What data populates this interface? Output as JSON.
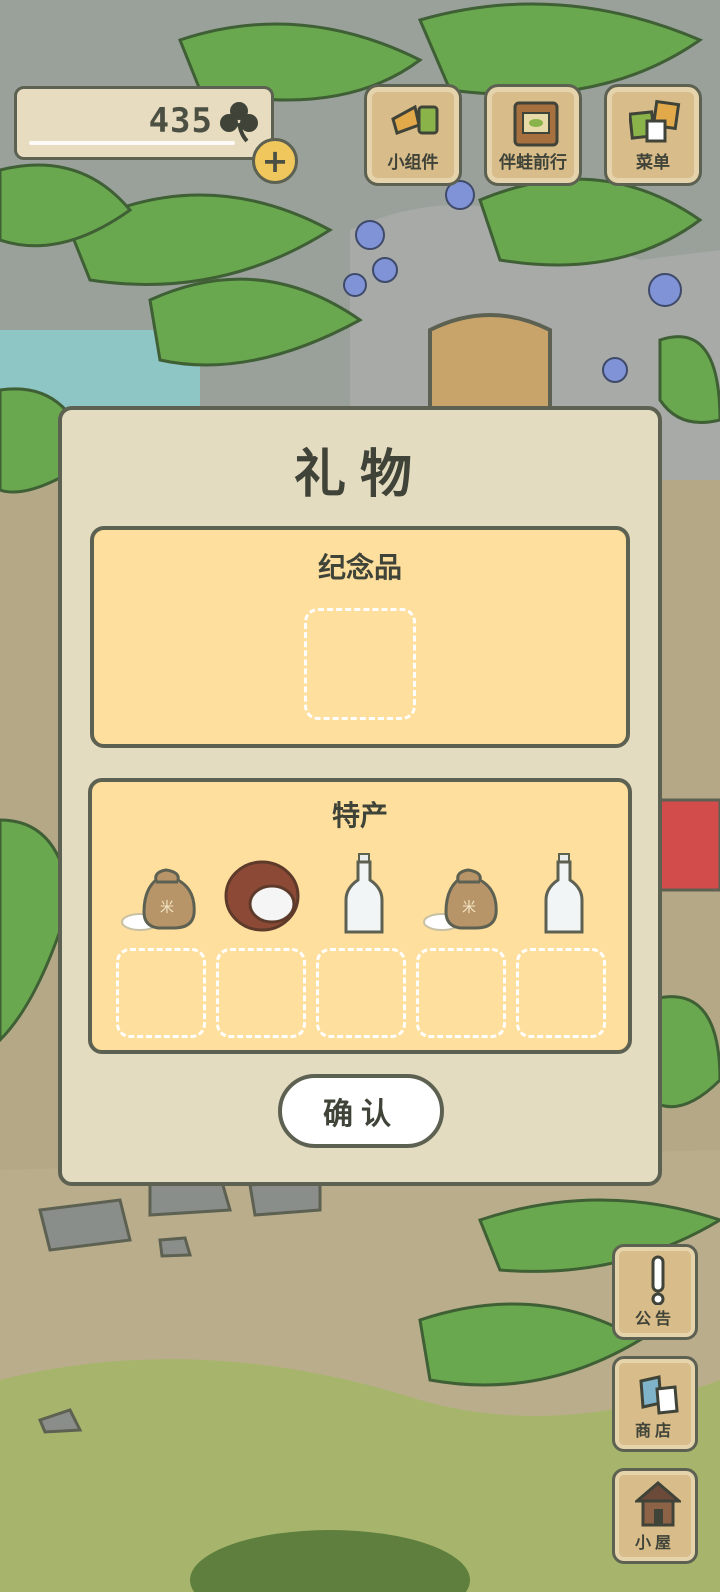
{
  "hud": {
    "clover_count": "435",
    "clover_icon": "clover-icon",
    "add_icon": "plus-icon"
  },
  "top_menu": [
    {
      "label": "小组件",
      "icon": "widget-icon"
    },
    {
      "label": "伴蛙前行",
      "icon": "book-icon"
    },
    {
      "label": "菜单",
      "icon": "menu-cards-icon"
    }
  ],
  "side_menu": [
    {
      "label": "公告",
      "icon": "exclamation-icon"
    },
    {
      "label": "商店",
      "icon": "shop-bags-icon"
    },
    {
      "label": "小屋",
      "icon": "house-icon"
    }
  ],
  "dialog": {
    "title": "礼物",
    "souvenir": {
      "title": "纪念品"
    },
    "specialty": {
      "title": "特产",
      "items": [
        "rice-sack-icon",
        "coconut-icon",
        "bottle-icon",
        "rice-sack-icon",
        "bottle-icon"
      ]
    },
    "confirm_label": "确认"
  },
  "colors": {
    "panel": "#fedf9e",
    "dialog_bg": "#e4dcc0",
    "outline": "#5d6152",
    "button_wood": "#d8bc8a"
  }
}
